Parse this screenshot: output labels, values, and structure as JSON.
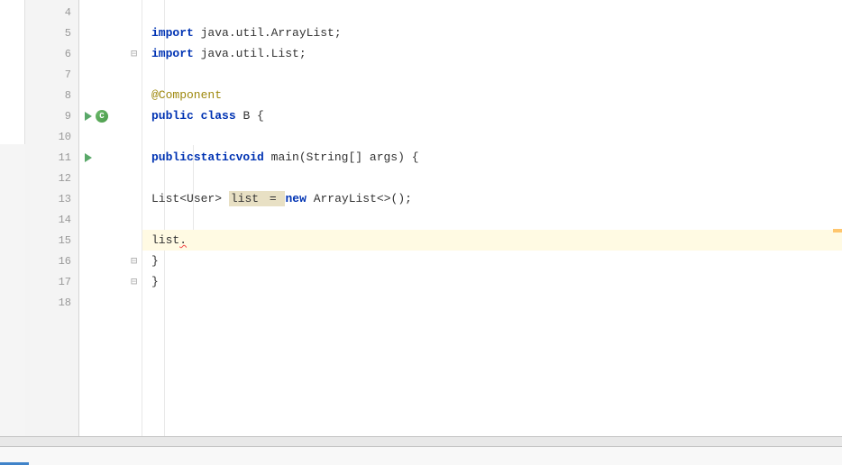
{
  "gutter": {
    "lines": [
      "4",
      "5",
      "6",
      "7",
      "8",
      "9",
      "10",
      "11",
      "12",
      "13",
      "14",
      "15",
      "16",
      "17",
      "18"
    ]
  },
  "code": {
    "line5": {
      "import": "import",
      "pkg": " java.util.ArrayList;"
    },
    "line6": {
      "import": "import",
      "pkg": " java.util.List;"
    },
    "line8": "@Component",
    "line9": {
      "pub": "public",
      "cls": "class",
      "name": " B ",
      "brace": "{"
    },
    "line11": {
      "pub": "public",
      "stat": "static",
      "void": "void",
      "main": " main",
      "open": "(",
      "type": "String",
      "brackets": "[]",
      "args": " args",
      "close": ") {"
    },
    "line13": {
      "type1": "List",
      "lt": "<",
      "user": "User",
      "gt": "> ",
      "var": "list",
      "eq": " = ",
      "new": "new",
      "type2": " ArrayList",
      "diamond": "<>",
      "end": "();"
    },
    "line15": {
      "var": "list",
      "dot": "."
    },
    "line16": "}",
    "line17": "}"
  }
}
